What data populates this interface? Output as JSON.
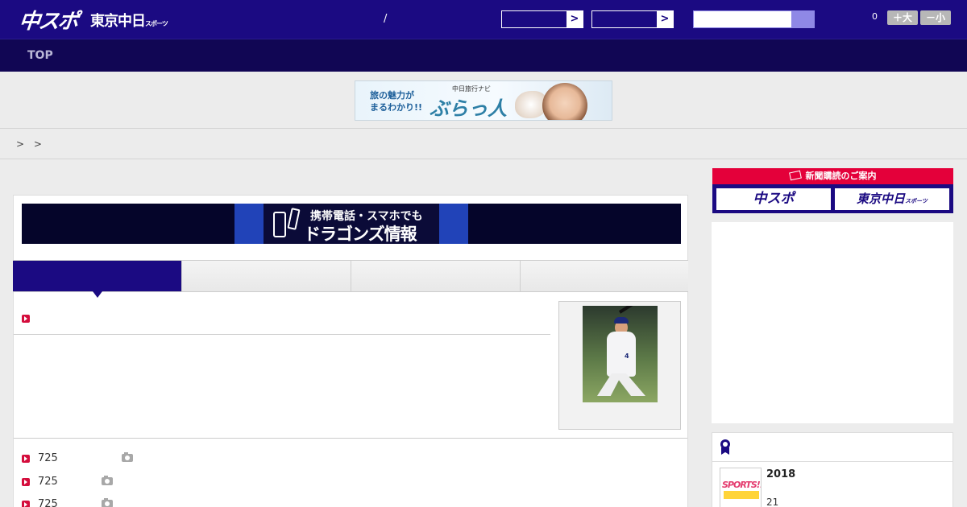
{
  "header": {
    "logo_chuspo": "中スポ",
    "logo_tokyo": "東京中日",
    "logo_tokyo_small": "スポーツ",
    "separator": "/",
    "select_arrow": ">",
    "font_size_count": "0",
    "font_larger_label": "＋大",
    "font_smaller_label": "－小"
  },
  "nav": {
    "top_label": "TOP"
  },
  "top_ad": {
    "line1": "旅の魅力が",
    "line2": "まるわかり!!",
    "brand_small": "中日旅行ナビ",
    "brand": "ぶらっ人"
  },
  "breadcrumb": {
    "text": "> >"
  },
  "banner": {
    "line1": "携帯電話・スマホでも",
    "line2": "ドラゴンズ情報"
  },
  "article_list": [
    {
      "text": "725"
    },
    {
      "text": "725"
    },
    {
      "text": "725"
    }
  ],
  "sidebar": {
    "subscribe_title": "新聞購読のご案内",
    "subscribe_chuspo": "中スポ",
    "subscribe_tokyo": "東京中日",
    "subscribe_tokyo_small": "スポーツ",
    "award": {
      "thumb_text": "SPORTS!!",
      "year": "2018",
      "count": "21"
    }
  },
  "colors": {
    "brand_navy": "#1b0a82",
    "nav_dark": "#110654",
    "accent_red": "#d40d3c"
  }
}
